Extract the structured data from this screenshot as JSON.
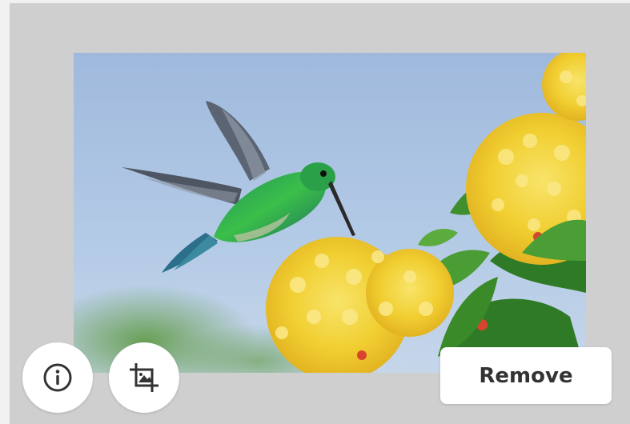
{
  "photo": {
    "subject": "hummingbird-with-yellow-flowers"
  },
  "toolbar": {
    "info_icon": "info-icon",
    "crop_icon": "crop-image-icon",
    "remove_label": "Remove"
  },
  "colors": {
    "panel_background": "#cfcfcf",
    "button_background": "#ffffff",
    "button_text": "#333333",
    "sky": "#a9c3e3",
    "bird_green": "#2fa84a",
    "flower_yellow": "#f4d43a"
  }
}
